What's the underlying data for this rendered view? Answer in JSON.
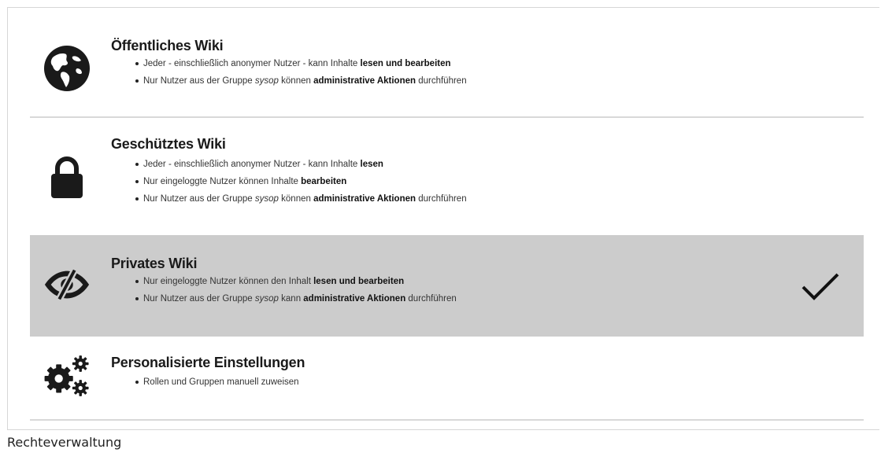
{
  "options": [
    {
      "title": "Öffentliches Wiki",
      "icon": "globe-icon",
      "selected": false,
      "bullets": [
        {
          "pre": "Jeder - einschließlich anonymer Nutzer - kann Inhalte ",
          "em": "",
          "mid": "",
          "bold": "lesen und bearbeiten",
          "post": ""
        },
        {
          "pre": "Nur Nutzer aus der Gruppe ",
          "em": "sysop",
          "mid": " können ",
          "bold": "administrative Aktionen",
          "post": " durchführen"
        }
      ]
    },
    {
      "title": "Geschütztes Wiki",
      "icon": "lock-icon",
      "selected": false,
      "bullets": [
        {
          "pre": "Jeder - einschließlich anonymer Nutzer - kann Inhalte ",
          "em": "",
          "mid": "",
          "bold": "lesen",
          "post": ""
        },
        {
          "pre": "Nur eingeloggte Nutzer können Inhalte ",
          "em": "",
          "mid": "",
          "bold": "bearbeiten",
          "post": ""
        },
        {
          "pre": "Nur Nutzer aus der Gruppe ",
          "em": "sysop",
          "mid": " können ",
          "bold": "administrative Aktionen",
          "post": " durchführen"
        }
      ]
    },
    {
      "title": "Privates Wiki",
      "icon": "eye-slash-icon",
      "selected": true,
      "bullets": [
        {
          "pre": "Nur eingeloggte Nutzer können den Inhalt ",
          "em": "",
          "mid": "",
          "bold": "lesen und bearbeiten",
          "post": ""
        },
        {
          "pre": "Nur Nutzer aus der Gruppe ",
          "em": "sysop",
          "mid": " kann ",
          "bold": "administrative Aktionen",
          "post": " durchführen"
        }
      ]
    },
    {
      "title": "Personalisierte Einstellungen",
      "icon": "gears-icon",
      "selected": false,
      "bullets": [
        {
          "pre": "Rollen und Gruppen manuell zuweisen",
          "em": "",
          "mid": "",
          "bold": "",
          "post": ""
        }
      ]
    }
  ],
  "selected_icon": "checkmark-icon",
  "caption": "Rechteverwaltung",
  "colors": {
    "selected_background": "#cccccc",
    "separator": "#d8d8d8",
    "icon": "#1a1a1a"
  }
}
